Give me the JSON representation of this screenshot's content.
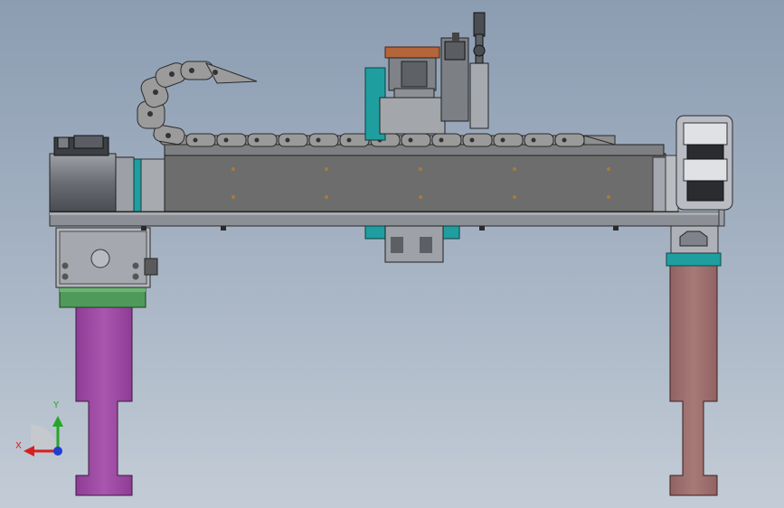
{
  "viewport": {
    "kind": "cad-3d-viewport",
    "view": "front",
    "background_top": "#8c9db2",
    "background_bottom": "#c3ccd6"
  },
  "model": {
    "assembly": "gantry-linear-module",
    "parts": [
      "servo-motor",
      "linear-axis-module",
      "cable-drag-chain",
      "z-axis-carriage",
      "cylinder-sensor",
      "base-plate",
      "left-column",
      "right-column",
      "cable-tray",
      "linear-guide-block"
    ],
    "colors": {
      "module_body": "#6d6d6d",
      "plate": "#8a8d93",
      "chain": "#8f8f8f",
      "left_column": "#9d4aa3",
      "right_column": "#a07070",
      "green_block": "#4f9a5a",
      "teal": "#1f9ea0",
      "copper": "#b5653a"
    }
  },
  "triad": {
    "x_label": "X",
    "y_label": "Y",
    "x_color": "#d42020",
    "y_color": "#26a626",
    "z_color": "#1f3fd0"
  }
}
